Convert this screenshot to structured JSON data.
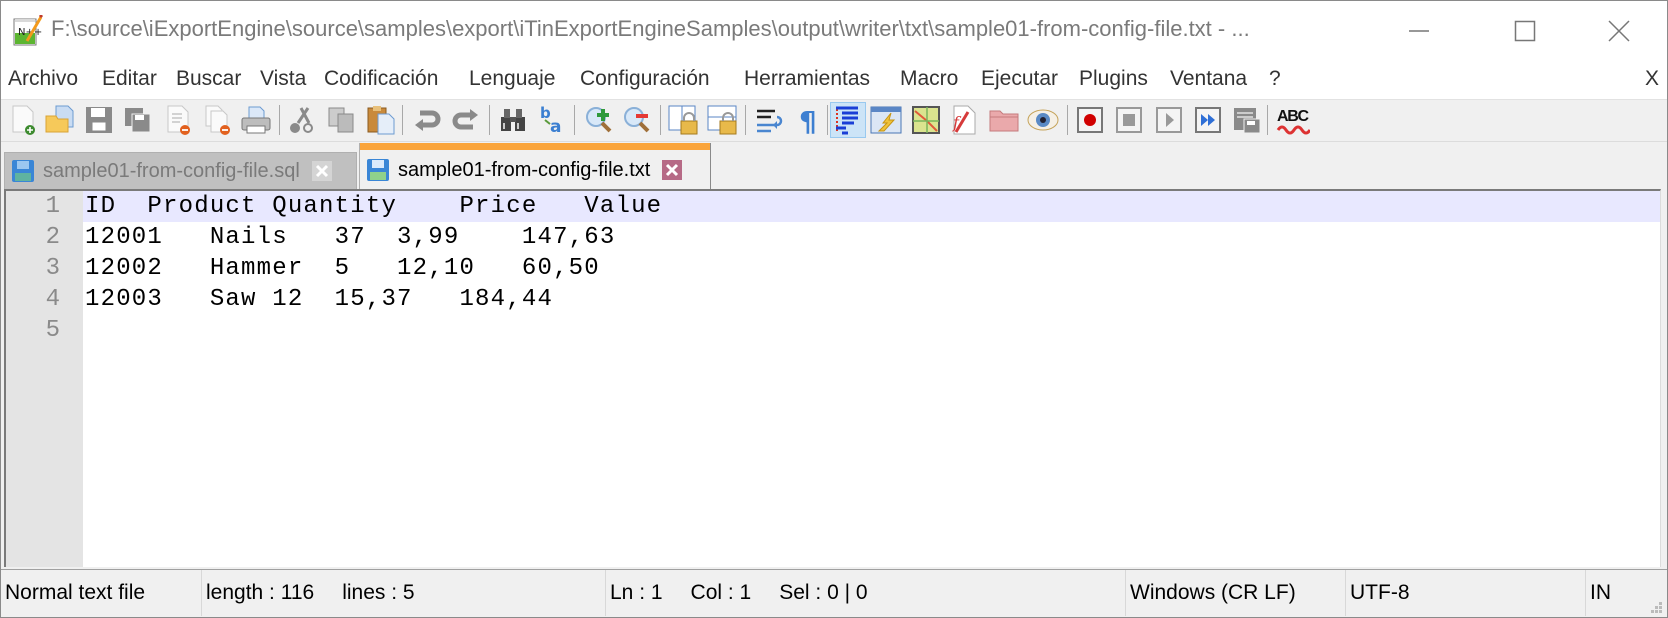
{
  "window": {
    "title": "F:\\source\\iExportEngine\\source\\samples\\export\\iTinExportEngineSamples\\output\\writer\\txt\\sample01-from-config-file.txt - ...",
    "app_icon": "notepad-plus-plus-icon",
    "controls": {
      "minimize": "minimize-icon",
      "maximize": "maximize-icon",
      "close": "close-icon"
    }
  },
  "menu": {
    "items": [
      "Archivo",
      "Editar",
      "Buscar",
      "Vista",
      "Codificación",
      "Lenguaje",
      "Configuración",
      "Herramientas",
      "Macro",
      "Ejecutar",
      "Plugins",
      "Ventana",
      "?"
    ],
    "close_doc": "X"
  },
  "toolbar": {
    "buttons": [
      {
        "id": "new",
        "icon": "new-file-icon"
      },
      {
        "id": "open",
        "icon": "open-folder-icon"
      },
      {
        "id": "save",
        "icon": "save-icon"
      },
      {
        "id": "save-all",
        "icon": "save-all-icon"
      },
      {
        "id": "close",
        "icon": "close-file-icon"
      },
      {
        "id": "close-all",
        "icon": "close-all-icon"
      },
      {
        "id": "print",
        "icon": "print-icon"
      },
      {
        "id": "cut",
        "icon": "cut-icon"
      },
      {
        "id": "copy",
        "icon": "copy-icon"
      },
      {
        "id": "paste",
        "icon": "paste-icon"
      },
      {
        "id": "undo",
        "icon": "undo-icon"
      },
      {
        "id": "redo",
        "icon": "redo-icon"
      },
      {
        "id": "find",
        "icon": "find-icon"
      },
      {
        "id": "replace",
        "icon": "replace-icon"
      },
      {
        "id": "zoom-in",
        "icon": "zoom-in-icon"
      },
      {
        "id": "zoom-out",
        "icon": "zoom-out-icon"
      },
      {
        "id": "sync-vertical",
        "icon": "sync-vertical-scroll-icon"
      },
      {
        "id": "sync-horizontal",
        "icon": "sync-horizontal-scroll-icon"
      },
      {
        "id": "word-wrap",
        "icon": "word-wrap-icon"
      },
      {
        "id": "show-all-chars",
        "icon": "pilcrow-icon"
      },
      {
        "id": "indent-guide",
        "icon": "indent-guide-icon",
        "active": true
      },
      {
        "id": "user-defined-language",
        "icon": "udl-icon"
      },
      {
        "id": "document-map",
        "icon": "document-map-icon"
      },
      {
        "id": "function-list",
        "icon": "function-list-icon"
      },
      {
        "id": "folder-as-workspace",
        "icon": "folder-workspace-icon"
      },
      {
        "id": "monitoring",
        "icon": "eye-icon"
      },
      {
        "id": "macro-record",
        "icon": "record-icon"
      },
      {
        "id": "macro-stop",
        "icon": "stop-icon"
      },
      {
        "id": "macro-play",
        "icon": "play-icon"
      },
      {
        "id": "macro-play-multiple",
        "icon": "fast-forward-icon"
      },
      {
        "id": "macro-save",
        "icon": "save-macro-icon"
      },
      {
        "id": "spell-check",
        "icon": "spell-check-icon",
        "label": "ABC"
      }
    ]
  },
  "tabs": [
    {
      "label": "sample01-from-config-file.sql",
      "active": false
    },
    {
      "label": "sample01-from-config-file.txt",
      "active": true
    }
  ],
  "editor": {
    "current_line": 1,
    "lines": [
      {
        "n": "1",
        "text": "ID  Product Quantity    Price   Value"
      },
      {
        "n": "2",
        "text": "12001   Nails   37  3,99    147,63"
      },
      {
        "n": "3",
        "text": "12002   Hammer  5   12,10   60,50"
      },
      {
        "n": "4",
        "text": "12003   Saw 12  15,37   184,44"
      },
      {
        "n": "5",
        "text": ""
      }
    ]
  },
  "status": {
    "file_type": "Normal text file",
    "length": "length : 116",
    "lines": "lines : 5",
    "ln": "Ln : 1",
    "col": "Col : 1",
    "sel": "Sel : 0 | 0",
    "eol": "Windows (CR LF)",
    "encoding": "UTF-8",
    "mode": "IN"
  },
  "colors": {
    "tab_accent": "#faa43a",
    "current_line": "#e8e8ff",
    "gutter": "#e4e4e4"
  }
}
